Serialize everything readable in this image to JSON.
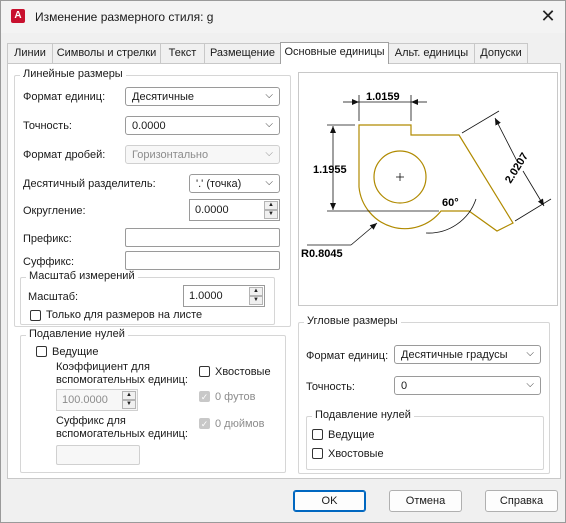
{
  "window": {
    "title": "Изменение размерного стиля: g",
    "icon_letter": "A"
  },
  "tabs": [
    {
      "label": "Линии"
    },
    {
      "label": "Символы и стрелки"
    },
    {
      "label": "Текст"
    },
    {
      "label": "Размещение"
    },
    {
      "label": "Основные единицы"
    },
    {
      "label": "Альт. единицы"
    },
    {
      "label": "Допуски"
    }
  ],
  "linear": {
    "group_title": "Линейные размеры",
    "unit_format_label": "Формат единиц:",
    "unit_format_value": "Десятичные",
    "precision_label": "Точность:",
    "precision_value": "0.0000",
    "fraction_label": "Формат дробей:",
    "fraction_value": "Горизонтально",
    "decimal_sep_label": "Десятичный  разделитель:",
    "decimal_sep_value": "'.' (точка)",
    "round_label": "Округление:",
    "round_value": "0.0000",
    "prefix_label": "Префикс:",
    "prefix_value": "",
    "suffix_label": "Суффикс:",
    "suffix_value": ""
  },
  "scale": {
    "group_title": "Масштаб измерений",
    "scale_label": "Масштаб:",
    "scale_value": "1.0000",
    "layout_only_label": "Только для размеров на листе"
  },
  "zero_linear": {
    "group_title": "Подавление нулей",
    "leading_label": "Ведущие",
    "sub_factor_label_1": "Коэффициент для",
    "sub_factor_label_2": "вспомогательных единиц:",
    "sub_factor_value": "100.0000",
    "trailing_label": "Хвостовые",
    "feet_label": "0 футов",
    "sub_suffix_label_1": "Суффикс для",
    "sub_suffix_label_2": "вспомогательных единиц:",
    "inches_label": "0 дюймов"
  },
  "angular": {
    "group_title": "Угловые размеры",
    "unit_format_label": "Формат единиц:",
    "unit_format_value": "Десятичные градусы",
    "precision_label": "Точность:",
    "precision_value": "0",
    "zero_title": "Подавление нулей",
    "leading_label": "Ведущие",
    "trailing_label": "Хвостовые"
  },
  "preview": {
    "dim_top": "1.0159",
    "dim_left": "1.1955",
    "dim_right": "2.0207",
    "angle": "60°",
    "radius": "R0.8045"
  },
  "buttons": {
    "ok": "OK",
    "cancel": "Отмена",
    "help": "Справка"
  },
  "colors": {
    "accent": "#0067c0",
    "geometry": "#b08a00",
    "app_icon": "#c8102e"
  }
}
